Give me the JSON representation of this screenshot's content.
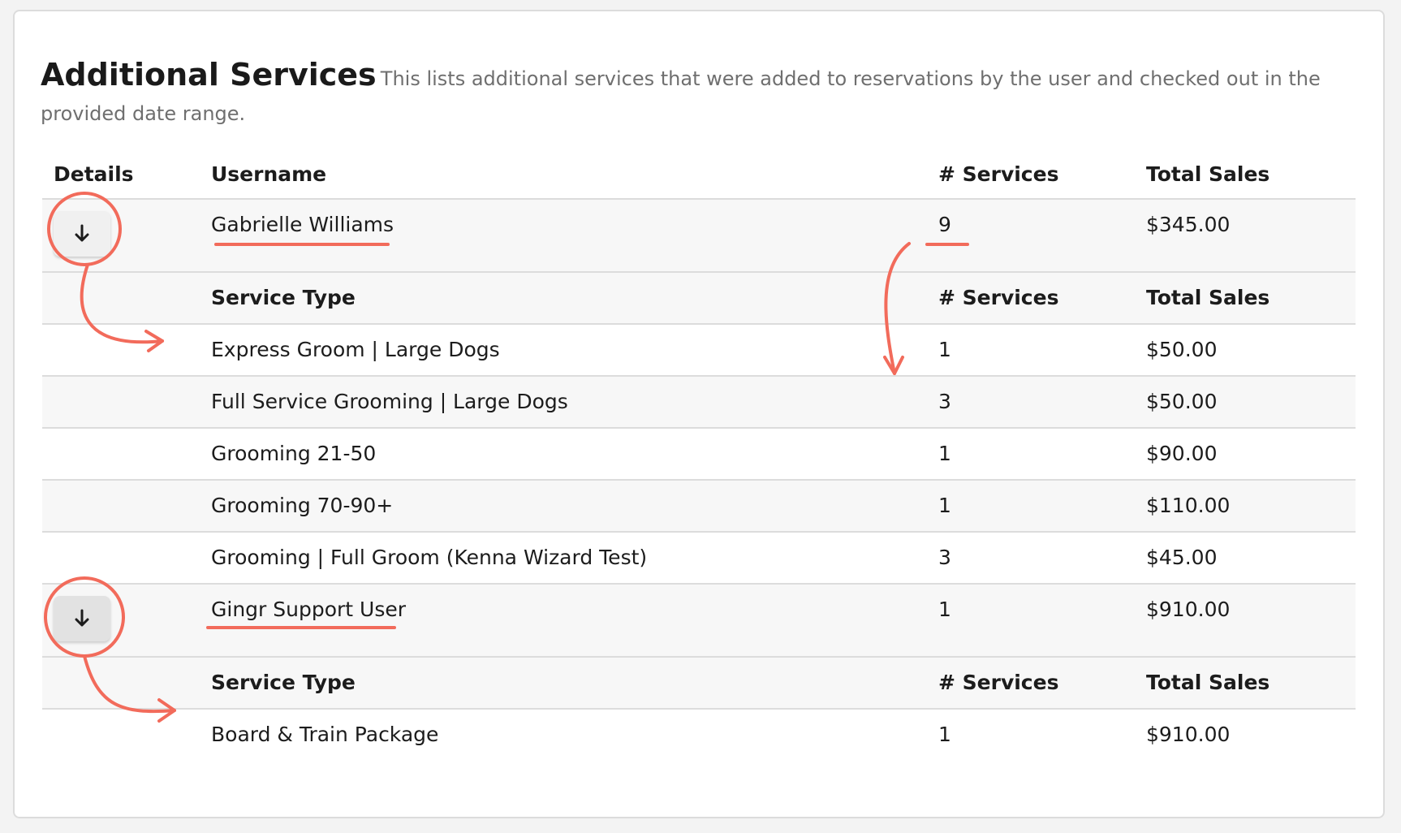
{
  "header": {
    "title": "Additional Services",
    "subtitle": "This lists additional services that were added to reservations by the user and checked out in the provided date range."
  },
  "table": {
    "columns": {
      "details": "Details",
      "username": "Username",
      "services": "# Services",
      "sales": "Total Sales"
    },
    "users": [
      {
        "username": "Gabrielle Williams",
        "services": "9",
        "sales": "$345.00",
        "expand_icon": "arrow-down-icon",
        "sub_header": {
          "type": "Service Type",
          "services": "# Services",
          "sales": "Total Sales"
        },
        "items": [
          {
            "type": "Express Groom | Large Dogs",
            "services": "1",
            "sales": "$50.00"
          },
          {
            "type": "Full Service Grooming | Large Dogs",
            "services": "3",
            "sales": "$50.00"
          },
          {
            "type": "Grooming 21-50",
            "services": "1",
            "sales": "$90.00"
          },
          {
            "type": "Grooming 70-90+",
            "services": "1",
            "sales": "$110.00"
          },
          {
            "type": "Grooming | Full Groom (Kenna Wizard Test)",
            "services": "3",
            "sales": "$45.00"
          }
        ]
      },
      {
        "username": "Gingr Support User",
        "services": "1",
        "sales": "$910.00",
        "expand_icon": "arrow-down-icon",
        "sub_header": {
          "type": "Service Type",
          "services": "# Services",
          "sales": "Total Sales"
        },
        "items": [
          {
            "type": "Board & Train Package",
            "services": "1",
            "sales": "$910.00"
          }
        ]
      }
    ]
  },
  "colors": {
    "annotation": "#f26b5b",
    "row_shade": "#f7f7f7",
    "border": "#dcdcdc",
    "subtitle": "#6f6f6f"
  }
}
